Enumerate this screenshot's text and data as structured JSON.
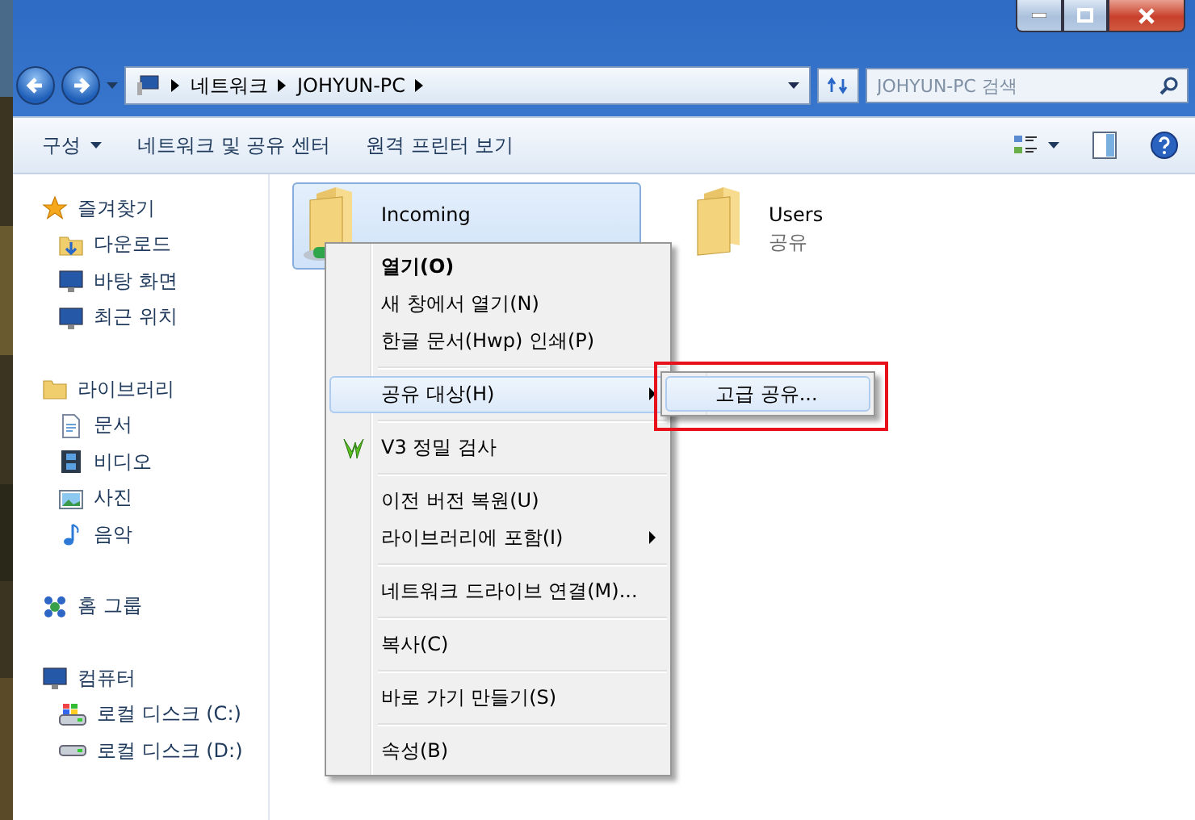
{
  "nav": {
    "breadcrumb": [
      "네트워크",
      "JOHYUN-PC"
    ],
    "search": {
      "placeholder": "JOHYUN-PC 검색"
    }
  },
  "toolbar": {
    "items": [
      {
        "label": "구성",
        "dropdown": true
      },
      {
        "label": "네트워크 및 공유 센터",
        "dropdown": false
      },
      {
        "label": "원격 프린터 보기",
        "dropdown": false
      }
    ]
  },
  "sidebar": {
    "groups": [
      {
        "label": "즐겨찾기",
        "children": [
          {
            "label": "다운로드"
          },
          {
            "label": "바탕 화면"
          },
          {
            "label": "최근 위치"
          }
        ]
      },
      {
        "label": "라이브러리",
        "children": [
          {
            "label": "문서"
          },
          {
            "label": "비디오"
          },
          {
            "label": "사진"
          },
          {
            "label": "음악"
          }
        ]
      },
      {
        "label": "홈 그룹"
      },
      {
        "label": "컴퓨터",
        "children": [
          {
            "label": "로컬 디스크 (C:)"
          },
          {
            "label": "로컬 디스크 (D:)"
          }
        ]
      }
    ]
  },
  "files": [
    {
      "name": "Incoming",
      "selected": true
    },
    {
      "name": "Users",
      "subtitle": "공유",
      "selected": false
    }
  ],
  "context_menu": {
    "items": [
      {
        "kind": "item",
        "label": "열기(O)",
        "bold": true,
        "selected": false,
        "submenu": false,
        "icon": false
      },
      {
        "kind": "item",
        "label": "새 창에서 열기(N)",
        "bold": false,
        "selected": false,
        "submenu": false,
        "icon": false
      },
      {
        "kind": "item",
        "label": "한글 문서(Hwp) 인쇄(P)",
        "bold": false,
        "selected": false,
        "submenu": false,
        "icon": false
      },
      {
        "kind": "separator"
      },
      {
        "kind": "item",
        "label": "공유 대상(H)",
        "bold": false,
        "selected": true,
        "submenu": true,
        "icon": false
      },
      {
        "kind": "separator"
      },
      {
        "kind": "item",
        "label": "V3 정밀 검사",
        "bold": false,
        "selected": false,
        "submenu": false,
        "icon": true
      },
      {
        "kind": "separator"
      },
      {
        "kind": "item",
        "label": "이전 버전 복원(U)",
        "bold": false,
        "selected": false,
        "submenu": false,
        "icon": false
      },
      {
        "kind": "item",
        "label": "라이브러리에 포함(I)",
        "bold": false,
        "selected": false,
        "submenu": true,
        "icon": false
      },
      {
        "kind": "separator"
      },
      {
        "kind": "item",
        "label": "네트워크 드라이브 연결(M)...",
        "bold": false,
        "selected": false,
        "submenu": false,
        "icon": false
      },
      {
        "kind": "separator"
      },
      {
        "kind": "item",
        "label": "복사(C)",
        "bold": false,
        "selected": false,
        "submenu": false,
        "icon": false
      },
      {
        "kind": "separator"
      },
      {
        "kind": "item",
        "label": "바로 가기 만들기(S)",
        "bold": false,
        "selected": false,
        "submenu": false,
        "icon": false
      },
      {
        "kind": "separator"
      },
      {
        "kind": "item",
        "label": "속성(B)",
        "bold": false,
        "selected": false,
        "submenu": false,
        "icon": false
      }
    ]
  },
  "submenu": {
    "highlight_box": true,
    "items": [
      {
        "label": "고급 공유...",
        "selected": true
      }
    ]
  }
}
